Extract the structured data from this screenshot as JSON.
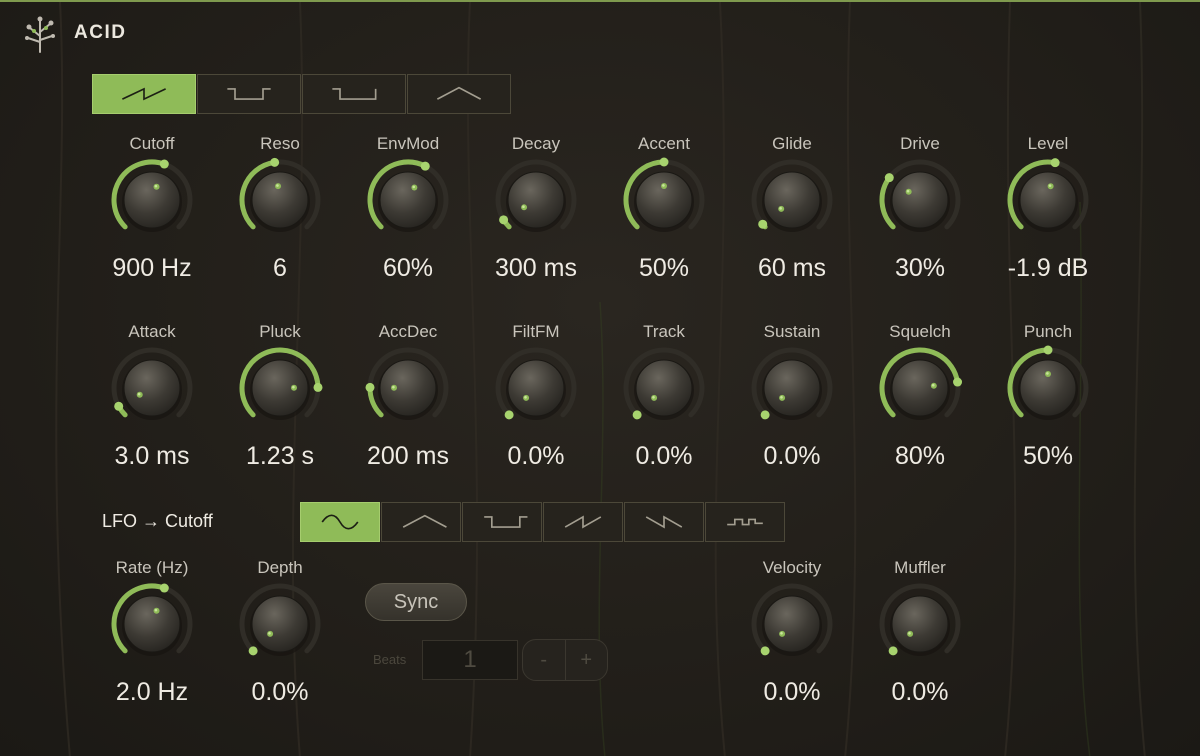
{
  "header": {
    "title": "ACID",
    "logo_icon": "plant-sprout-icon"
  },
  "colors": {
    "accent": "#8fbb58",
    "background": "#23201b",
    "text": "#efebe3",
    "label": "#c9c5bc"
  },
  "osc_waveforms": [
    {
      "icon": "saw-wave-icon",
      "active": true
    },
    {
      "icon": "square-wave-icon",
      "active": false
    },
    {
      "icon": "pulse-wave-icon",
      "active": false
    },
    {
      "icon": "triangle-wave-icon",
      "active": false
    }
  ],
  "knob_rows": [
    [
      {
        "label": "Cutoff",
        "value": "900 Hz",
        "level": 0.57
      },
      {
        "label": "Reso",
        "value": "6",
        "level": 0.47
      },
      {
        "label": "EnvMod",
        "value": "60%",
        "level": 0.6
      },
      {
        "label": "Decay",
        "value": "300 ms",
        "level": 0.05
      },
      {
        "label": "Accent",
        "value": "50%",
        "level": 0.5
      },
      {
        "label": "Glide",
        "value": "60 ms",
        "level": 0.02
      },
      {
        "label": "Drive",
        "value": "30%",
        "level": 0.3
      },
      {
        "label": "Level",
        "value": "-1.9 dB",
        "level": 0.54
      }
    ],
    [
      {
        "label": "Attack",
        "value": "3.0 ms",
        "level": 0.06
      },
      {
        "label": "Pluck",
        "value": "1.23 s",
        "level": 0.83
      },
      {
        "label": "AccDec",
        "value": "200 ms",
        "level": 0.17
      },
      {
        "label": "FiltFM",
        "value": "0.0%",
        "level": 0.0
      },
      {
        "label": "Track",
        "value": "0.0%",
        "level": 0.0
      },
      {
        "label": "Sustain",
        "value": "0.0%",
        "level": 0.0
      },
      {
        "label": "Squelch",
        "value": "80%",
        "level": 0.8
      },
      {
        "label": "Punch",
        "value": "50%",
        "level": 0.5
      }
    ]
  ],
  "lfo": {
    "label": "LFO → Cutoff",
    "waveforms": [
      {
        "icon": "sine-wave-icon",
        "active": true
      },
      {
        "icon": "triangle-wave-icon",
        "active": false
      },
      {
        "icon": "square-wave-icon",
        "active": false
      },
      {
        "icon": "saw-up-wave-icon",
        "active": false
      },
      {
        "icon": "saw-down-wave-icon",
        "active": false
      },
      {
        "icon": "sample-hold-wave-icon",
        "active": false
      }
    ],
    "knobs": [
      {
        "label": "Rate (Hz)",
        "value": "2.0 Hz",
        "level": 0.57
      },
      {
        "label": "Depth",
        "value": "0.0%",
        "level": 0.0
      }
    ],
    "sync_label": "Sync",
    "beats_label": "Beats",
    "beats_value": "1",
    "minus_label": "-",
    "plus_label": "+"
  },
  "extra_knobs": [
    {
      "label": "Velocity",
      "value": "0.0%",
      "level": 0.0
    },
    {
      "label": "Muffler",
      "value": "0.0%",
      "level": 0.0
    }
  ]
}
